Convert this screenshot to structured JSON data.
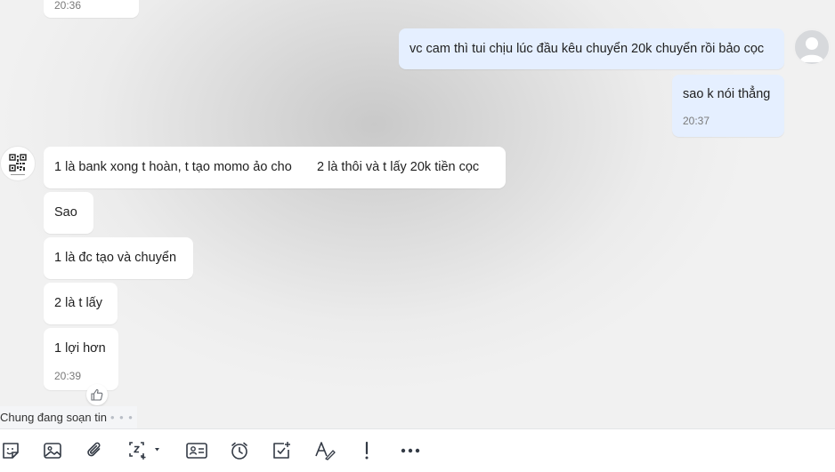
{
  "conversation": {
    "top_partial_time": "20:36",
    "outgoing": [
      {
        "text": "vc cam thì tui chịu lúc đầu kêu chuyển 20k chuyển rồi bảo cọc"
      },
      {
        "text": "sao k nói thẳng",
        "time": "20:37"
      }
    ],
    "incoming": [
      {
        "text": "1 là bank xong t hoàn, t tạo momo ảo cho       2 là thôi và t lấy 20k tiền cọc"
      },
      {
        "text": "Sao"
      },
      {
        "text": "1 là đc tạo và chuyển"
      },
      {
        "text": "2 là t lấy"
      },
      {
        "text": "1 lợi hơn",
        "time": "20:39"
      }
    ]
  },
  "typing_indicator": {
    "text": "Chung đang soạn tin",
    "dots": "• • •"
  },
  "toolbar": {
    "icons": [
      "sticker-icon",
      "image-icon",
      "attachment-icon",
      "screenshot-icon",
      "contact-card-icon",
      "reminder-icon",
      "task-icon",
      "format-text-icon",
      "urgent-icon",
      "more-icon"
    ]
  },
  "colors": {
    "outgoing_bubble": "#e5efff",
    "incoming_bubble": "#ffffff",
    "icon": "#333a45"
  }
}
